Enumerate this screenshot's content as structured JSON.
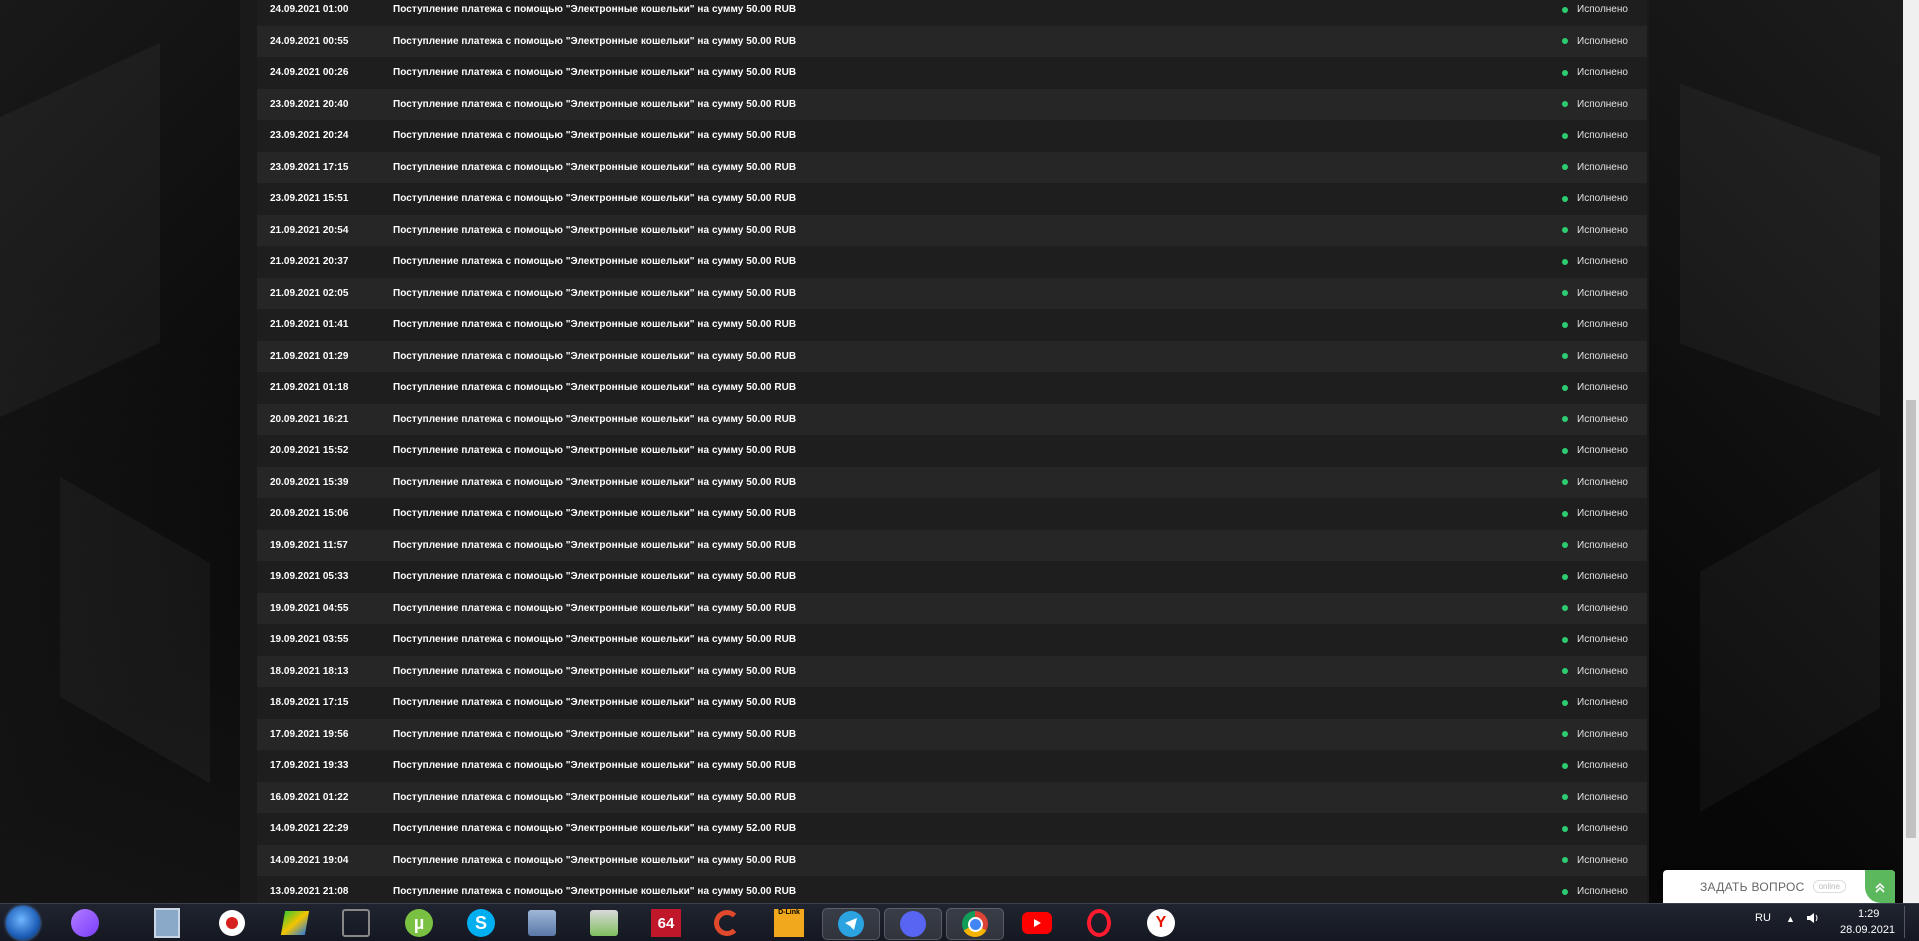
{
  "transactions": [
    {
      "date": "24.09.2021 01:00",
      "description": "Поступление платежа с помощью \"Электронные кошельки\" на сумму 50.00 RUB",
      "status": "Исполнено"
    },
    {
      "date": "24.09.2021 00:55",
      "description": "Поступление платежа с помощью \"Электронные кошельки\" на сумму 50.00 RUB",
      "status": "Исполнено"
    },
    {
      "date": "24.09.2021 00:26",
      "description": "Поступление платежа с помощью \"Электронные кошельки\" на сумму 50.00 RUB",
      "status": "Исполнено"
    },
    {
      "date": "23.09.2021 20:40",
      "description": "Поступление платежа с помощью \"Электронные кошельки\" на сумму 50.00 RUB",
      "status": "Исполнено"
    },
    {
      "date": "23.09.2021 20:24",
      "description": "Поступление платежа с помощью \"Электронные кошельки\" на сумму 50.00 RUB",
      "status": "Исполнено"
    },
    {
      "date": "23.09.2021 17:15",
      "description": "Поступление платежа с помощью \"Электронные кошельки\" на сумму 50.00 RUB",
      "status": "Исполнено"
    },
    {
      "date": "23.09.2021 15:51",
      "description": "Поступление платежа с помощью \"Электронные кошельки\" на сумму 50.00 RUB",
      "status": "Исполнено"
    },
    {
      "date": "21.09.2021 20:54",
      "description": "Поступление платежа с помощью \"Электронные кошельки\" на сумму 50.00 RUB",
      "status": "Исполнено"
    },
    {
      "date": "21.09.2021 20:37",
      "description": "Поступление платежа с помощью \"Электронные кошельки\" на сумму 50.00 RUB",
      "status": "Исполнено"
    },
    {
      "date": "21.09.2021 02:05",
      "description": "Поступление платежа с помощью \"Электронные кошельки\" на сумму 50.00 RUB",
      "status": "Исполнено"
    },
    {
      "date": "21.09.2021 01:41",
      "description": "Поступление платежа с помощью \"Электронные кошельки\" на сумму 50.00 RUB",
      "status": "Исполнено"
    },
    {
      "date": "21.09.2021 01:29",
      "description": "Поступление платежа с помощью \"Электронные кошельки\" на сумму 50.00 RUB",
      "status": "Исполнено"
    },
    {
      "date": "21.09.2021 01:18",
      "description": "Поступление платежа с помощью \"Электронные кошельки\" на сумму 50.00 RUB",
      "status": "Исполнено"
    },
    {
      "date": "20.09.2021 16:21",
      "description": "Поступление платежа с помощью \"Электронные кошельки\" на сумму 50.00 RUB",
      "status": "Исполнено"
    },
    {
      "date": "20.09.2021 15:52",
      "description": "Поступление платежа с помощью \"Электронные кошельки\" на сумму 50.00 RUB",
      "status": "Исполнено"
    },
    {
      "date": "20.09.2021 15:39",
      "description": "Поступление платежа с помощью \"Электронные кошельки\" на сумму 50.00 RUB",
      "status": "Исполнено"
    },
    {
      "date": "20.09.2021 15:06",
      "description": "Поступление платежа с помощью \"Электронные кошельки\" на сумму 50.00 RUB",
      "status": "Исполнено"
    },
    {
      "date": "19.09.2021 11:57",
      "description": "Поступление платежа с помощью \"Электронные кошельки\" на сумму 50.00 RUB",
      "status": "Исполнено"
    },
    {
      "date": "19.09.2021 05:33",
      "description": "Поступление платежа с помощью \"Электронные кошельки\" на сумму 50.00 RUB",
      "status": "Исполнено"
    },
    {
      "date": "19.09.2021 04:55",
      "description": "Поступление платежа с помощью \"Электронные кошельки\" на сумму 50.00 RUB",
      "status": "Исполнено"
    },
    {
      "date": "19.09.2021 03:55",
      "description": "Поступление платежа с помощью \"Электронные кошельки\" на сумму 50.00 RUB",
      "status": "Исполнено"
    },
    {
      "date": "18.09.2021 18:13",
      "description": "Поступление платежа с помощью \"Электронные кошельки\" на сумму 50.00 RUB",
      "status": "Исполнено"
    },
    {
      "date": "18.09.2021 17:15",
      "description": "Поступление платежа с помощью \"Электронные кошельки\" на сумму 50.00 RUB",
      "status": "Исполнено"
    },
    {
      "date": "17.09.2021 19:56",
      "description": "Поступление платежа с помощью \"Электронные кошельки\" на сумму 50.00 RUB",
      "status": "Исполнено"
    },
    {
      "date": "17.09.2021 19:33",
      "description": "Поступление платежа с помощью \"Электронные кошельки\" на сумму 50.00 RUB",
      "status": "Исполнено"
    },
    {
      "date": "16.09.2021 01:22",
      "description": "Поступление платежа с помощью \"Электронные кошельки\" на сумму 50.00 RUB",
      "status": "Исполнено"
    },
    {
      "date": "14.09.2021 22:29",
      "description": "Поступление платежа с помощью \"Электронные кошельки\" на сумму 52.00 RUB",
      "status": "Исполнено"
    },
    {
      "date": "14.09.2021 19:04",
      "description": "Поступление платежа с помощью \"Электронные кошельки\" на сумму 50.00 RUB",
      "status": "Исполнено"
    },
    {
      "date": "13.09.2021 21:08",
      "description": "Поступление платежа с помощью \"Электронные кошельки\" на сумму 50.00 RUB",
      "status": "Исполнено"
    }
  ],
  "colors": {
    "status_ok": "#2ecc71",
    "widget_accent": "#5cb85c",
    "row_odd": "#1e1e1e",
    "row_even": "#262626"
  },
  "chat_widget": {
    "label": "ЗАДАТЬ ВОПРОС",
    "badge": "online",
    "icon": "double-chevron-up-icon"
  },
  "taskbar": {
    "icons": [
      {
        "name": "start-orb-icon"
      },
      {
        "name": "alice-assistant-icon"
      },
      {
        "name": "file-manager-icon"
      },
      {
        "name": "screen-recorder-icon"
      },
      {
        "name": "bluestacks-icon"
      },
      {
        "name": "gaming-app-icon"
      },
      {
        "name": "utorrent-icon",
        "label": "µ"
      },
      {
        "name": "skype-icon",
        "label": "S"
      },
      {
        "name": "security-app-icon"
      },
      {
        "name": "archive-app-icon"
      },
      {
        "name": "aida64-icon",
        "label": "64"
      },
      {
        "name": "ccleaner-icon"
      },
      {
        "name": "dlink-icon",
        "label": "D-Link"
      },
      {
        "name": "telegram-icon"
      },
      {
        "name": "discord-icon"
      },
      {
        "name": "chrome-icon"
      },
      {
        "name": "youtube-icon"
      },
      {
        "name": "opera-icon"
      },
      {
        "name": "yandex-browser-icon",
        "label": "Y"
      }
    ],
    "language": "RU",
    "time": "1:29",
    "date": "28.09.2021"
  }
}
